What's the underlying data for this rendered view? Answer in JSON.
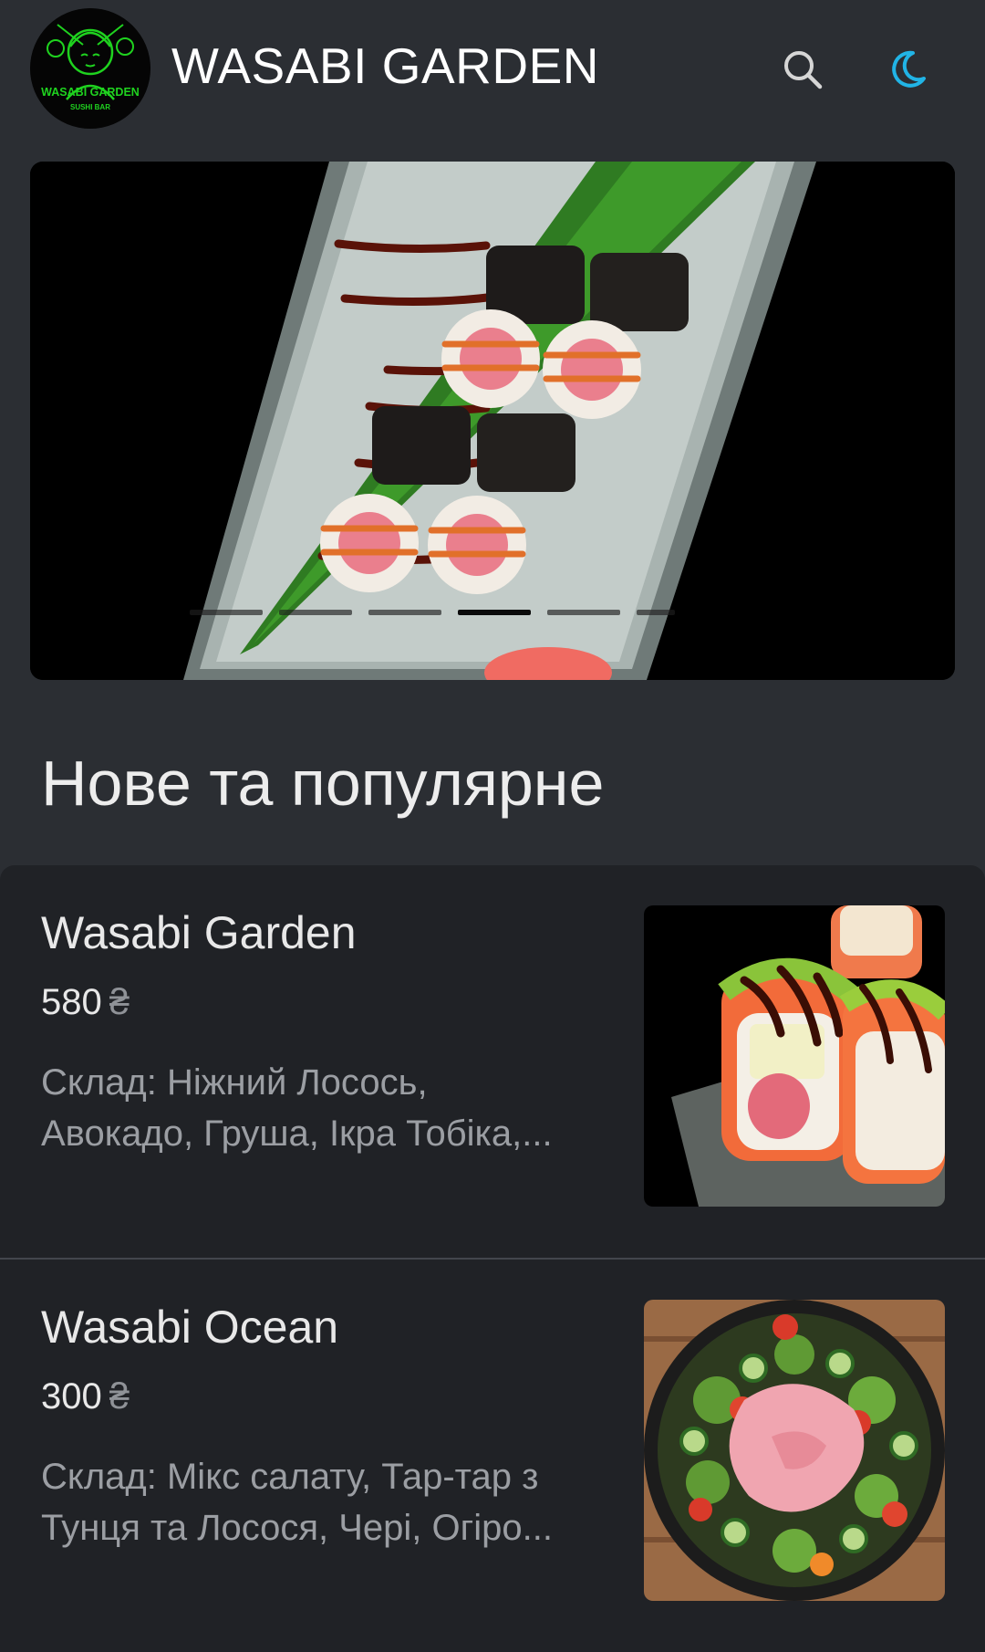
{
  "header": {
    "app_title": "WASABI GARDEN",
    "logo_text": "WASABI GARDEN",
    "logo_subtext": "SUSHI BAR",
    "logo_icon": "geisha-logo",
    "search_icon": "search-icon",
    "theme_icon": "moon-icon",
    "accent_color": "#21b4e6"
  },
  "banner": {
    "slides_count": 6,
    "active_slide": 4
  },
  "section": {
    "title": "Нове та популярне"
  },
  "menu_items": [
    {
      "name": "Wasabi Garden",
      "price": "580",
      "currency": "₴",
      "description": "Склад: Ніжний Лосось, Авокадо, Груша, Ікра Тобіка,..."
    },
    {
      "name": "Wasabi Ocean",
      "price": "300",
      "currency": "₴",
      "description": "Склад: Мікс салату, Тар-тар з Тунця та Лосося, Чері, Огіро..."
    }
  ]
}
